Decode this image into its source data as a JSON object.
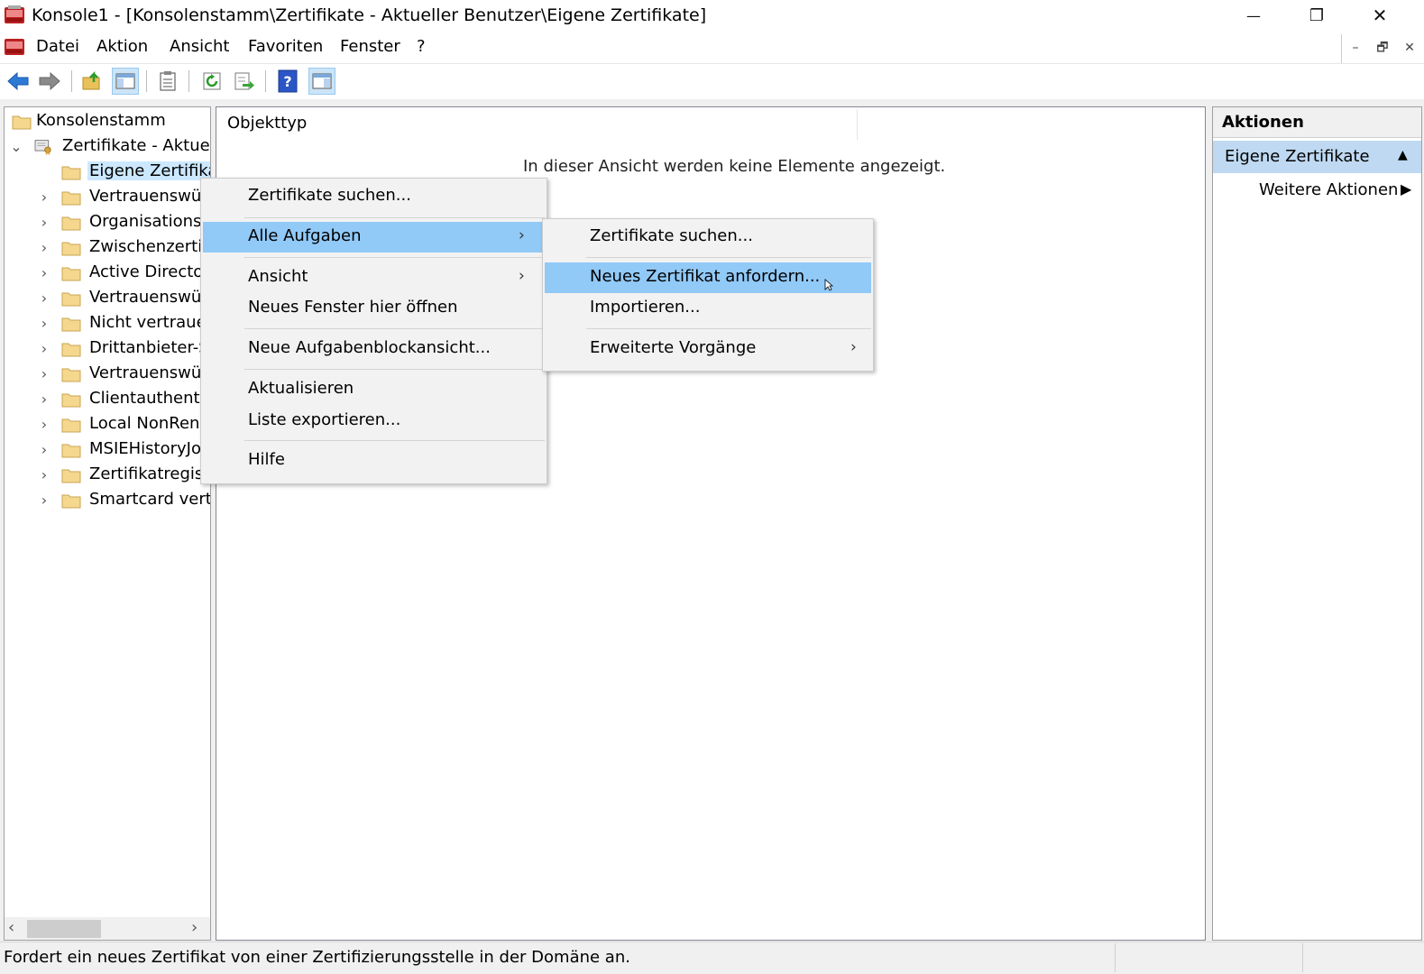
{
  "window": {
    "title": "Konsole1 - [Konsolenstamm\\Zertifikate - Aktueller Benutzer\\Eigene Zertifikate]",
    "minimize_glyph": "—",
    "restore_glyph": "❐",
    "close_glyph": "✕"
  },
  "menubar": {
    "items": [
      "Datei",
      "Aktion",
      "Ansicht",
      "Favoriten",
      "Fenster",
      "?"
    ],
    "mdi_minimize": "–",
    "mdi_restore": "🗗",
    "mdi_close": "✕"
  },
  "toolbar": {
    "buttons": [
      "back-arrow-icon",
      "forward-arrow-icon",
      "up-folder-icon",
      "show-hide-tree-icon",
      "properties-clipboard-icon",
      "refresh-icon",
      "export-list-icon",
      "help-icon",
      "show-hide-action-pane-icon"
    ]
  },
  "tree": {
    "root": "Konsolenstamm",
    "snapin": "Zertifikate - Aktuell",
    "items": [
      "Eigene Zertifikat",
      "Vertrauenswür",
      "Organisations",
      "Zwischenzerti",
      "Active Directo",
      "Vertrauenswür",
      "Nicht vertraue",
      "Drittanbieter-S",
      "Vertrauenswür",
      "Clientauthent",
      "Local NonRen",
      "MSIEHistoryJo",
      "Zertifikatregis",
      "Smartcard vertra"
    ]
  },
  "center": {
    "column_header": "Objekttyp",
    "empty_message": "In dieser Ansicht werden keine Elemente angezeigt."
  },
  "actions_pane": {
    "header": "Aktionen",
    "section": "Eigene Zertifikate",
    "more": "Weitere Aktionen"
  },
  "context_menu": {
    "items": {
      "find": "Zertifikate suchen...",
      "all_tasks": "Alle Aufgaben",
      "view": "Ansicht",
      "new_window": "Neues Fenster hier öffnen",
      "new_taskpad": "Neue Aufgabenblockansicht...",
      "refresh": "Aktualisieren",
      "export": "Liste exportieren...",
      "help": "Hilfe"
    }
  },
  "submenu": {
    "items": {
      "find": "Zertifikate suchen...",
      "request_new": "Neues Zertifikat anfordern...",
      "import": "Importieren...",
      "advanced": "Erweiterte Vorgänge"
    }
  },
  "statusbar": {
    "text": "Fordert ein neues Zertifikat von einer Zertifizierungsstelle in der Domäne an."
  },
  "colors": {
    "menu_highlight": "#91c9f7",
    "action_section": "#bfd9f2",
    "tree_selection": "#cce8ff",
    "folder_yellow": "#f5d78e"
  }
}
